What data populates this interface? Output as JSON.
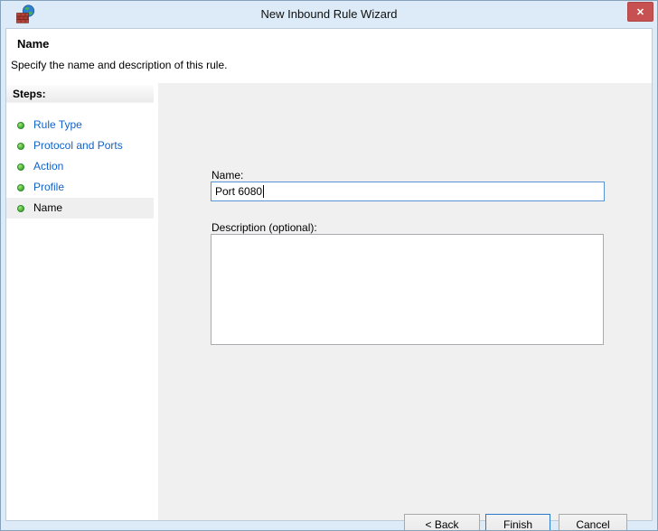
{
  "window": {
    "title": "New Inbound Rule Wizard",
    "close_glyph": "✕"
  },
  "header": {
    "title": "Name",
    "subtitle": "Specify the name and description of this rule."
  },
  "sidebar": {
    "heading": "Steps:",
    "items": [
      {
        "label": "Rule Type",
        "active": false
      },
      {
        "label": "Protocol and Ports",
        "active": false
      },
      {
        "label": "Action",
        "active": false
      },
      {
        "label": "Profile",
        "active": false
      },
      {
        "label": "Name",
        "active": true
      }
    ]
  },
  "form": {
    "name_label": "Name:",
    "name_value": "Port 6080",
    "description_label": "Description (optional):",
    "description_value": ""
  },
  "buttons": {
    "back": "< Back",
    "finish": "Finish",
    "cancel": "Cancel"
  },
  "colors": {
    "frame": "#dcebf7",
    "frame_border": "#86a2bb",
    "close_button": "#c75050",
    "header_bg": "#ffffff",
    "sidebar_bg": "#ffffff",
    "content_bg": "#f0f0f0",
    "step_link": "#0f62c8",
    "step_bullet_green": "#3fa33b",
    "active_step_bg": "#efefef",
    "input_border_focused": "#5794d8",
    "textarea_border": "#a9abb0",
    "default_button_border": "#2a7ac9"
  }
}
